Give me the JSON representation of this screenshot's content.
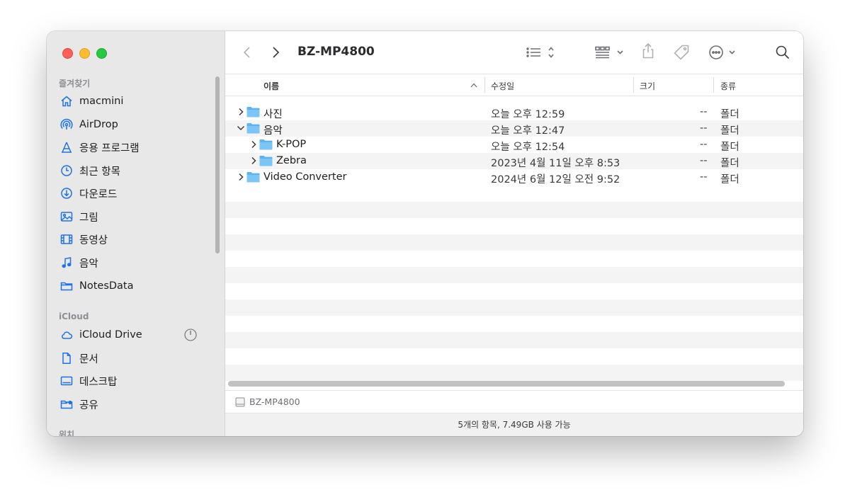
{
  "window_title": "BZ-MP4800",
  "sidebar": {
    "favorites_title": "즐겨찾기",
    "favorites": [
      {
        "label": "macmini",
        "icon": "home-icon"
      },
      {
        "label": "AirDrop",
        "icon": "airdrop-icon"
      },
      {
        "label": "응용 프로그램",
        "icon": "applications-icon"
      },
      {
        "label": "최근 항목",
        "icon": "clock-icon"
      },
      {
        "label": "다운로드",
        "icon": "download-icon"
      },
      {
        "label": "그림",
        "icon": "photo-icon"
      },
      {
        "label": "동영상",
        "icon": "film-icon"
      },
      {
        "label": "음악",
        "icon": "music-icon"
      },
      {
        "label": "NotesData",
        "icon": "folder-icon"
      }
    ],
    "icloud_title": "iCloud",
    "icloud": [
      {
        "label": "iCloud Drive",
        "icon": "cloud-icon"
      },
      {
        "label": "문서",
        "icon": "document-icon"
      },
      {
        "label": "데스크탑",
        "icon": "desktop-icon"
      },
      {
        "label": "공유",
        "icon": "shared-folder-icon"
      }
    ],
    "locations_title": "위치"
  },
  "columns": {
    "name": "이름",
    "modified": "수정일",
    "size": "크기",
    "kind": "종류"
  },
  "rows": [
    {
      "name": "사진",
      "date": "오늘 오후 12:59",
      "size": "--",
      "kind": "폴더",
      "level": 0,
      "expanded": false
    },
    {
      "name": "음악",
      "date": "오늘 오후 12:47",
      "size": "--",
      "kind": "폴더",
      "level": 0,
      "expanded": true
    },
    {
      "name": "K-POP",
      "date": "오늘 오후 12:54",
      "size": "--",
      "kind": "폴더",
      "level": 1,
      "expanded": false
    },
    {
      "name": "Zebra",
      "date": "2023년 4월 11일 오후 8:53",
      "size": "--",
      "kind": "폴더",
      "level": 1,
      "expanded": false
    },
    {
      "name": "Video Converter",
      "date": "2024년 6월 12일 오전 9:52",
      "size": "--",
      "kind": "폴더",
      "level": 0,
      "expanded": false
    }
  ],
  "pathbar": {
    "label": "BZ-MP4800",
    "icon": "disk-icon"
  },
  "status": "5개의 항목, 7.49GB 사용 가능",
  "colors": {
    "accent": "#1d73e8",
    "folder": "#5cb3f0",
    "sidebar_bg": "#e8e8e8"
  }
}
